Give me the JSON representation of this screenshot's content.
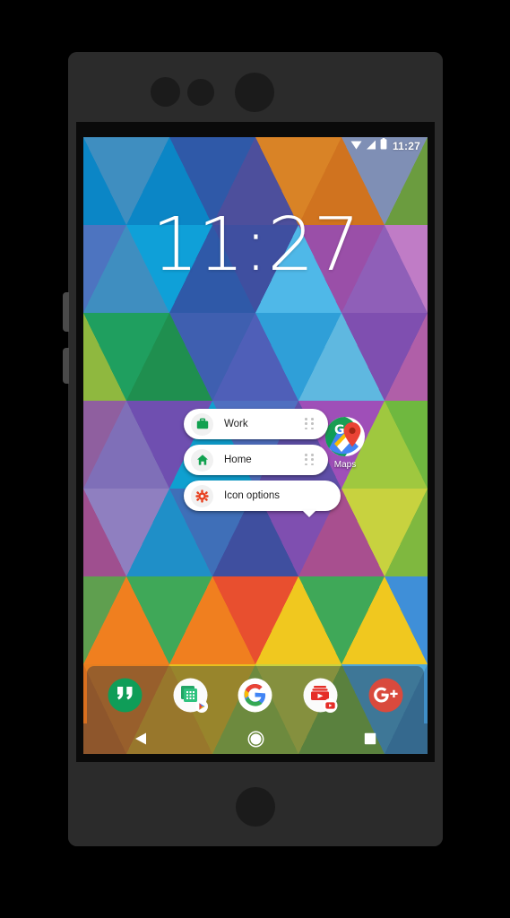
{
  "device": {
    "name": "android-phone",
    "frame_color": "#2b2b2b",
    "bezel_color": "#0a0a0a"
  },
  "status_bar": {
    "time": "11:27",
    "icons": [
      "wifi-icon",
      "signal-icon",
      "battery-icon"
    ]
  },
  "clock_widget": {
    "time": "11:27"
  },
  "home_screen": {
    "app_icon": {
      "label": "Maps",
      "icon": "google-maps-icon"
    },
    "app_drawer_indicator": "chevron-up-icon"
  },
  "popup_menu": {
    "items": [
      {
        "label": "Work",
        "icon": "briefcase-icon",
        "icon_color": "#12a150",
        "has_handle": true
      },
      {
        "label": "Home",
        "icon": "house-icon",
        "icon_color": "#12a150",
        "has_handle": true
      },
      {
        "label": "Icon options",
        "icon": "gear-icon",
        "icon_color": "#e8401f",
        "has_handle": false
      }
    ]
  },
  "dock": {
    "items": [
      {
        "label": "Hangouts",
        "icon": "hangouts-icon"
      },
      {
        "label": "Play Store",
        "icon": "play-store-folder-icon"
      },
      {
        "label": "Google",
        "icon": "google-g-icon"
      },
      {
        "label": "YouTube",
        "icon": "youtube-folder-icon"
      },
      {
        "label": "Google Plus",
        "icon": "google-plus-icon"
      }
    ]
  },
  "nav_bar": {
    "buttons": [
      {
        "label": "Back",
        "icon": "back-triangle-icon"
      },
      {
        "label": "Home",
        "icon": "home-circle-icon"
      },
      {
        "label": "Recents",
        "icon": "recents-square-icon"
      }
    ]
  },
  "colors": {
    "accent_green": "#12a150",
    "accent_red": "#e8401f",
    "dock_overlay": "rgba(40,52,62,.42)"
  }
}
